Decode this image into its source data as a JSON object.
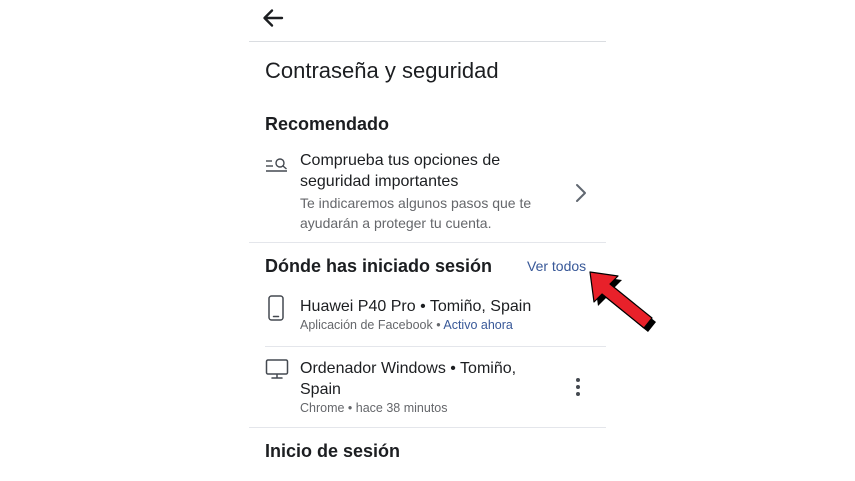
{
  "page": {
    "title": "Contraseña y seguridad"
  },
  "recommended": {
    "heading": "Recomendado",
    "item": {
      "title": "Comprueba tus opciones de seguridad importantes",
      "subtitle": "Te indicaremos algunos pasos que te ayudarán a proteger tu cuenta.",
      "icon": "search-list-icon"
    }
  },
  "sessions": {
    "heading": "Dónde has iniciado sesión",
    "see_all": "Ver todos",
    "items": [
      {
        "device": "Huawei P40 Pro • Tomiño, Spain",
        "app": "Aplicación de Facebook",
        "separator": " • ",
        "status": "Activo ahora",
        "icon": "phone-icon"
      },
      {
        "device": "Ordenador Windows • Tomiño, Spain",
        "detail": "Chrome • hace 38 minutos",
        "icon": "desktop-icon"
      }
    ]
  },
  "login": {
    "heading": "Inicio de sesión"
  },
  "colors": {
    "link": "#385898",
    "text": "#1c1e21",
    "secondary": "#65676b",
    "annotation_arrow": "#e8212a"
  }
}
